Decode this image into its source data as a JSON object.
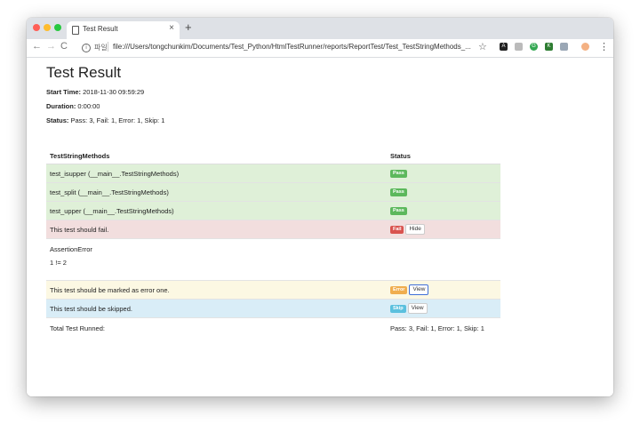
{
  "browser": {
    "tab_title": "Test Result",
    "tab_close": "×",
    "new_tab": "+",
    "url_scheme": "파일",
    "url": "file:///Users/tongchunkim/Documents/Test_Python/HtmlTestRunner/reports/ReportTest/Test_TestStringMethods_...",
    "back": "←",
    "forward": "→",
    "reload": "C",
    "star": "☆",
    "menu": "⋮",
    "extensions": [
      {
        "icon": "extension-a-icon",
        "text": "A",
        "color": "#222222"
      },
      {
        "icon": "extension-gray-icon",
        "text": "",
        "color": "#bbbbbb"
      },
      {
        "icon": "extension-g-icon",
        "text": "G",
        "color": "#34a853"
      },
      {
        "icon": "extension-k-icon",
        "text": "K",
        "color": "#2e7d32"
      },
      {
        "icon": "dropbox-icon",
        "text": "",
        "color": "#9aa7b5"
      },
      {
        "icon": "avatar-icon",
        "text": "",
        "color": "#f4b183"
      }
    ]
  },
  "report": {
    "title": "Test Result",
    "start_time_label": "Start Time:",
    "start_time": " 2018-11-30 09:59:29",
    "duration_label": "Duration:",
    "duration": " 0:00:00",
    "status_label": "Status:",
    "status": " Pass: 3, Fail: 1, Error: 1, Skip: 1",
    "table": {
      "col_name": "TestStringMethods",
      "col_status": "Status",
      "rows": [
        {
          "name": "test_isupper (__main__.TestStringMethods)",
          "status": "Pass",
          "type": "pass"
        },
        {
          "name": "test_split (__main__.TestStringMethods)",
          "status": "Pass",
          "type": "pass"
        },
        {
          "name": "test_upper (__main__.TestStringMethods)",
          "status": "Pass",
          "type": "pass"
        },
        {
          "name": "This test should fail.",
          "status": "Fail",
          "type": "fail",
          "button": "Hide"
        },
        {
          "name": "This test should be marked as error one.",
          "status": "Error",
          "type": "error",
          "button": "View"
        },
        {
          "name": "This test should be skipped.",
          "status": "Skip",
          "type": "skip",
          "button": "View"
        }
      ],
      "fail_detail_line1": "AssertionError",
      "fail_detail_line2": "1 != 2",
      "total_label": "Total Test Runned:",
      "total_value": "Pass: 3, Fail: 1, Error: 1, Skip: 1"
    }
  },
  "colors": {
    "pass_row": "#dff0d8",
    "fail_row": "#f2dede",
    "error_row": "#fcf8e3",
    "skip_row": "#d9edf7",
    "pass_label": "#5cb85c",
    "fail_label": "#d9534f",
    "error_label": "#f0ad4e",
    "skip_label": "#5bc0de"
  }
}
